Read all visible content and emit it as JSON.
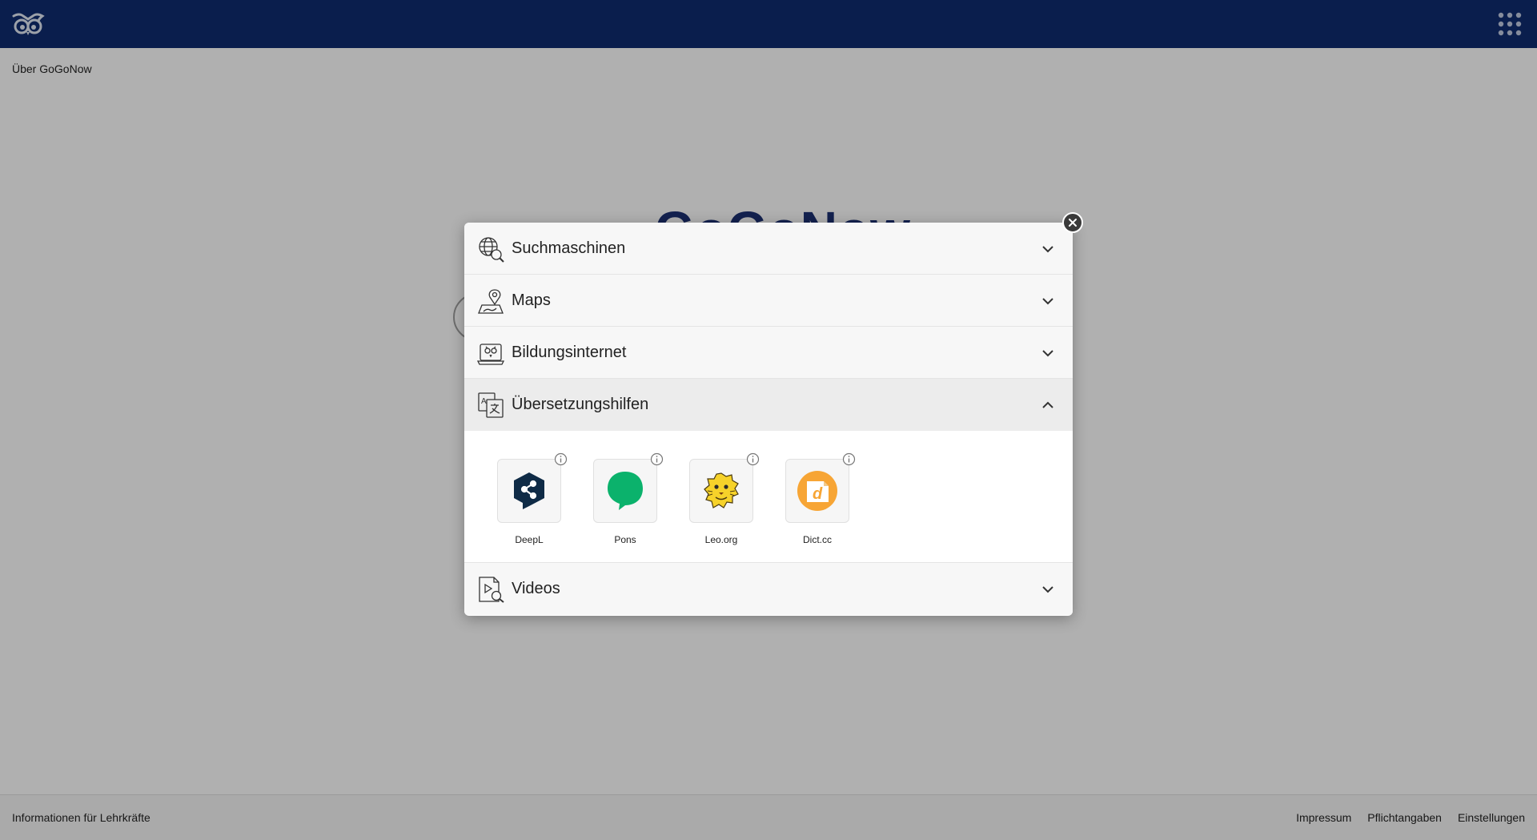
{
  "header": {
    "logo_icon": "owl-logo-icon",
    "apps_icon": "apps-grid-icon"
  },
  "nav": {
    "about_label": "Über GoGoNow"
  },
  "hero": {
    "title": "GoGoNow"
  },
  "modal": {
    "close_icon": "close-icon",
    "sections": [
      {
        "label": "Suchmaschinen",
        "icon": "globe-search-icon",
        "expanded": false
      },
      {
        "label": "Maps",
        "icon": "map-pin-icon",
        "expanded": false
      },
      {
        "label": "Bildungsinternet",
        "icon": "laptop-owl-icon",
        "expanded": false
      },
      {
        "label": "Übersetzungshilfen",
        "icon": "translate-icon",
        "expanded": true,
        "items": [
          {
            "label": "DeepL",
            "icon": "deepl-logo-icon"
          },
          {
            "label": "Pons",
            "icon": "pons-logo-icon"
          },
          {
            "label": "Leo.org",
            "icon": "leo-logo-icon"
          },
          {
            "label": "Dict.cc",
            "icon": "dictcc-logo-icon"
          }
        ]
      },
      {
        "label": "Videos",
        "icon": "video-search-icon",
        "expanded": false
      }
    ]
  },
  "footer": {
    "teachers_label": "Informationen für Lehrkräfte",
    "links": [
      "Impressum",
      "Pflichtangaben",
      "Einstellungen"
    ]
  },
  "colors": {
    "brand_navy": "#0f2a6b",
    "deepl_navy": "#0f2b46",
    "pons_green": "#0bb26c",
    "dictcc_orange": "#f7a535"
  }
}
